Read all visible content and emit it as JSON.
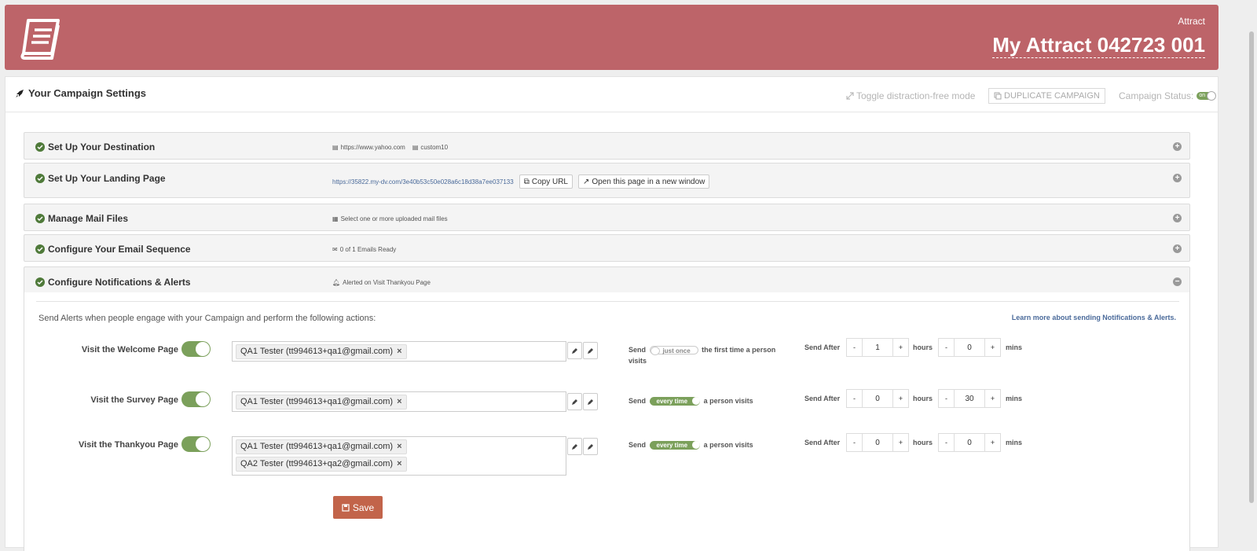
{
  "header": {
    "app_label": "Attract",
    "campaign_name": "My Attract 042723 001",
    "brand_color": "#bd6469"
  },
  "panel": {
    "title": "Your Campaign Settings",
    "toggle_mode": "Toggle distraction-free mode",
    "duplicate": "DUPLICATE CAMPAIGN",
    "status_label": "Campaign Status:",
    "status_value": "on"
  },
  "sections": [
    {
      "title": "Set Up Your Destination",
      "info": [
        "https://www.yahoo.com",
        "custom10"
      ]
    },
    {
      "title": "Set Up Your Landing Page",
      "info": [
        "https://35822.my-dv.com/3e40b53c50e028a6c18d38a7ee037133"
      ],
      "copy_url": "Copy URL",
      "open_page": "Open this page in a new window"
    },
    {
      "title": "Manage Mail Files",
      "info": [
        "Select one or more uploaded mail files"
      ]
    },
    {
      "title": "Configure Your Email Sequence",
      "info": [
        "0 of 1 Emails Ready"
      ]
    },
    {
      "title": "Configure Notifications & Alerts",
      "info": [
        "Alerted on Visit Thankyou Page"
      ]
    }
  ],
  "alerts": {
    "intro": "Send Alerts when people engage with your Campaign and perform the following actions:",
    "learn_more": "Learn more about sending Notifications & Alerts.",
    "send_word": "Send",
    "send_after": "Send After",
    "hours": "hours",
    "mins": "mins",
    "rows": [
      {
        "label": "Visit the Welcome Page",
        "recipients": [
          "QA1 Tester (tt994613+qa1@gmail.com)"
        ],
        "freq": "just once",
        "freq_suffix": "the first time a person",
        "freq_suffix2": "visits",
        "hours": "1",
        "mins": "0"
      },
      {
        "label": "Visit the Survey Page",
        "recipients": [
          "QA1 Tester (tt994613+qa1@gmail.com)"
        ],
        "freq": "every time",
        "freq_suffix": "a person visits",
        "hours": "0",
        "mins": "30"
      },
      {
        "label": "Visit the Thankyou Page",
        "recipients": [
          "QA1 Tester (tt994613+qa1@gmail.com)",
          "QA2 Tester (tt994613+qa2@gmail.com)"
        ],
        "freq": "every time",
        "freq_suffix": "a person visits",
        "hours": "0",
        "mins": "0"
      }
    ],
    "save_label": "Save"
  }
}
